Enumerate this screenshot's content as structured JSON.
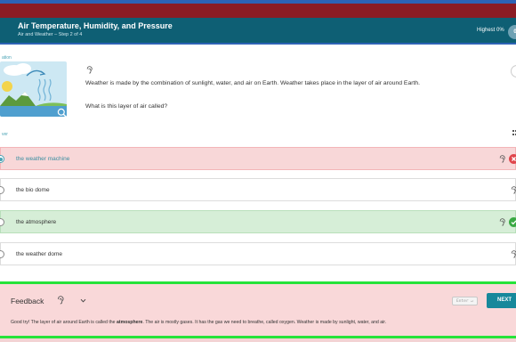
{
  "header": {
    "title": "Air Temperature, Humidity, and Pressure",
    "subtitle": "Air and Weather – Step 2 of 4",
    "score_label": "Highest 0%",
    "score_value": "0"
  },
  "question": {
    "section_label": "ation",
    "line1": "Weather is made by the combination of sunlight, water, and air on Earth. Weather takes place in the layer of air around Earth.",
    "line2": "What is this layer of air called?"
  },
  "answer": {
    "section_label": "ver",
    "options": [
      {
        "label": "the weather machine",
        "state": "wrong",
        "selected": true
      },
      {
        "label": "the bio dome",
        "state": "none",
        "selected": false
      },
      {
        "label": "the atmosphere",
        "state": "correct",
        "selected": false
      },
      {
        "label": "the weather dome",
        "state": "none",
        "selected": false
      }
    ]
  },
  "feedback": {
    "title": "Feedback",
    "enter_hint": "Enter ↵",
    "next_label": "NEXT",
    "text_before": "Good try! The layer of air around Earth is called the ",
    "text_bold": "atmosphere",
    "text_after": ". The air is mostly gases. It has the gas we need to breathe, called oxygen. Weather is made by sunlight, water, and air."
  },
  "colors": {
    "header_bg": "#0e5f74",
    "top_bar": "#8b1c24",
    "accent": "#17889b",
    "wrong": "#e0464c",
    "correct": "#3aa944",
    "feedback_border": "#26e33a"
  },
  "icons": {
    "audio": "ear-listen-icon",
    "zoom": "zoom-icon",
    "wrong": "x-circle-icon",
    "correct": "check-circle-icon",
    "expand": "chevron-down-icon"
  }
}
